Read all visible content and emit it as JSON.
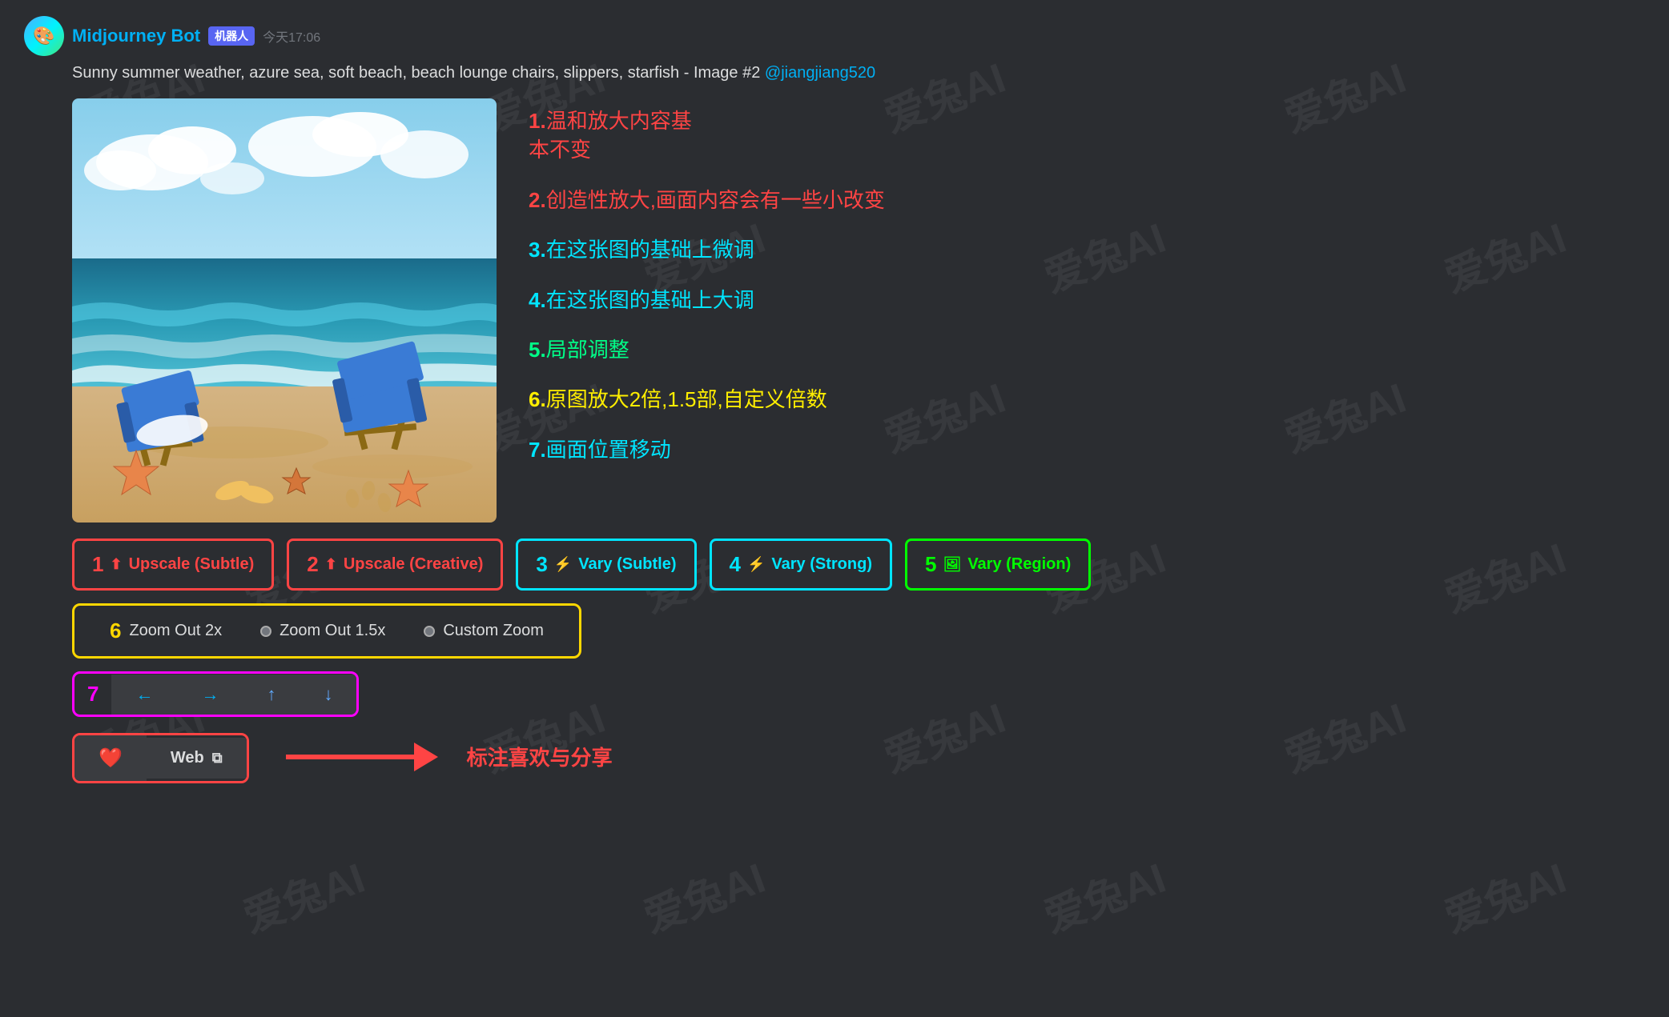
{
  "watermarks": [
    "爱兔AI",
    "爱兔AI",
    "爱兔AI"
  ],
  "header": {
    "bot_name": "Midjourney Bot",
    "bot_tag": "机器人",
    "timestamp": "今天17:06",
    "description": "Sunny summer weather, azure sea, soft beach, beach lounge chairs, slippers, starfish",
    "image_num": "- Image #2",
    "username": "@jiangjiang520"
  },
  "annotations": [
    {
      "num": "1",
      "text": "温和放大内容基\n本不变",
      "color": "ann-red"
    },
    {
      "num": "2",
      "text": "创造性放大,画面内容会有一些小改变",
      "color": "ann-red"
    },
    {
      "num": "3",
      "text": "在这张图的基础上微调",
      "color": "ann-cyan"
    },
    {
      "num": "4",
      "text": "在这张图的基础上大调",
      "color": "ann-cyan"
    },
    {
      "num": "5",
      "text": "局部调整",
      "color": "ann-green"
    },
    {
      "num": "6",
      "text": "原图放大2倍,1.5部,自定义倍数",
      "color": "ann-yellow"
    },
    {
      "num": "7",
      "text": "画面位置移动",
      "color": "ann-cyan"
    }
  ],
  "row1_buttons": [
    {
      "num": "1",
      "label": "Upscale (Subtle)",
      "style": "btn-red"
    },
    {
      "num": "2",
      "label": "Upscale (Creative)",
      "style": "btn-red"
    },
    {
      "num": "3",
      "label": "Vary (Subtle)",
      "style": "btn-cyan"
    },
    {
      "num": "4",
      "label": "Vary (Strong)",
      "style": "btn-cyan"
    },
    {
      "num": "5",
      "label": "Vary (Region)",
      "style": "btn-green"
    }
  ],
  "zoom_buttons": [
    {
      "num": "6",
      "label": "Zoom Out 2x"
    },
    {
      "label": "Zoom Out 1.5x"
    },
    {
      "label": "Custom Zoom"
    }
  ],
  "arrow_buttons": [
    {
      "icon": "←"
    },
    {
      "icon": "→"
    },
    {
      "icon": "↑"
    },
    {
      "icon": "↓"
    }
  ],
  "action_buttons": {
    "heart": "❤",
    "web_label": "Web",
    "web_icon": "⧉",
    "arrow_label": "标注喜欢与分享"
  }
}
